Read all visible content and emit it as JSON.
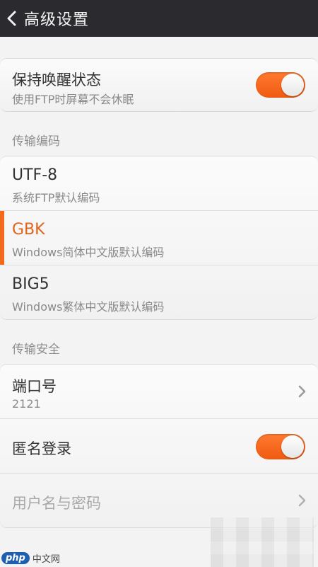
{
  "header": {
    "title": "高级设置",
    "back_icon": "chevron-left-icon"
  },
  "keep_awake": {
    "title": "保持唤醒状态",
    "subtitle": "使用FTP时屏幕不会休眠",
    "enabled": true
  },
  "encoding": {
    "section_label": "传输编码",
    "options": [
      {
        "title": "UTF-8",
        "subtitle": "系统FTP默认编码",
        "selected": false
      },
      {
        "title": "GBK",
        "subtitle": "Windows简体中文版默认编码",
        "selected": true
      },
      {
        "title": "BIG5",
        "subtitle": "Windows繁体中文版默认编码",
        "selected": false
      }
    ]
  },
  "security": {
    "section_label": "传输安全",
    "port": {
      "title": "端口号",
      "value": "2121"
    },
    "anonymous": {
      "title": "匿名登录",
      "enabled": true
    },
    "credentials": {
      "title": "用户名与密码",
      "disabled": true
    }
  },
  "watermark": {
    "logo": "php",
    "text": "中文网"
  },
  "colors": {
    "accent": "#f26a1b",
    "topbar": "#2b2b2f",
    "background": "#f3f3f3"
  }
}
